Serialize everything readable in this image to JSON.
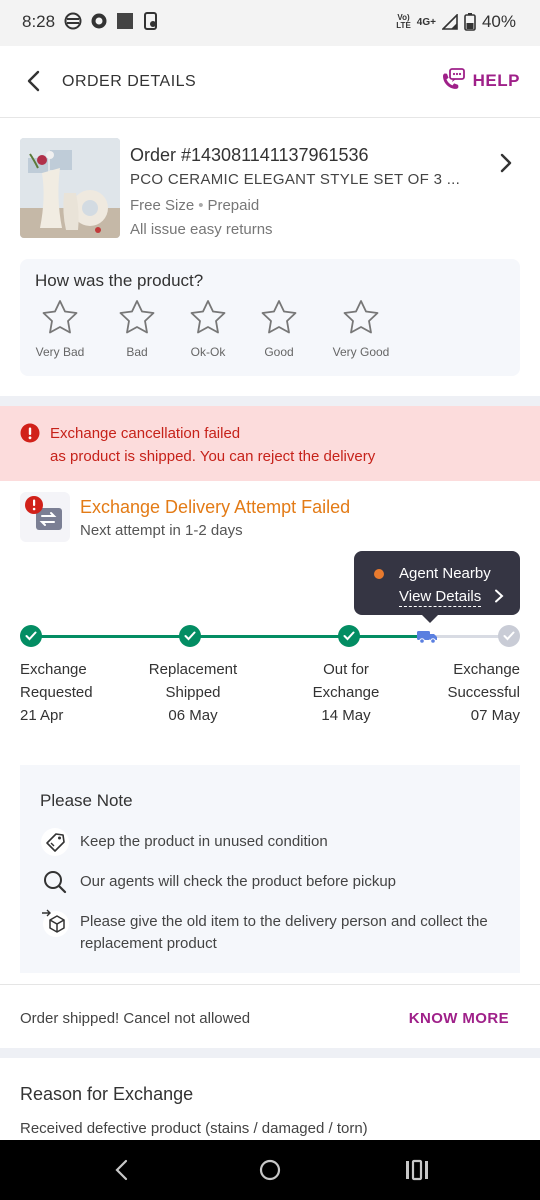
{
  "status_bar": {
    "time": "8:28",
    "network_top": "Vo)",
    "network_bottom": "LTE",
    "network_type": "4G+",
    "battery": "40%"
  },
  "header": {
    "title": "ORDER DETAILS",
    "help_label": "HELP",
    "accent_color": "#9f2089"
  },
  "order": {
    "id_text": "Order #143081141137961536",
    "product_name": "PCO CERAMIC ELEGANT STYLE SET OF 3 ...",
    "size": "Free Size",
    "payment": "Prepaid",
    "returns": "All issue easy returns"
  },
  "rating": {
    "question": "How was the product?",
    "options": [
      "Very Bad",
      "Bad",
      "Ok-Ok",
      "Good",
      "Very Good"
    ]
  },
  "error_banner": {
    "title": "Exchange cancellation failed",
    "subtitle": "as product is shipped. You can reject the delivery",
    "color": "#c6221a"
  },
  "attempt": {
    "title": "Exchange Delivery Attempt Failed",
    "subtitle": "Next attempt in 1-2 days",
    "color": "#e37b16"
  },
  "tooltip": {
    "label": "Agent Nearby",
    "link": "View Details"
  },
  "tracker": {
    "steps": [
      {
        "line1": "Exchange",
        "line2": "Requested",
        "date": "21 Apr",
        "status": "done"
      },
      {
        "line1": "Replacement",
        "line2": "Shipped",
        "date": "06 May",
        "status": "done"
      },
      {
        "line1": "Out for",
        "line2": "Exchange",
        "date": "14 May",
        "status": "done"
      },
      {
        "line1": "Exchange",
        "line2": "Successful",
        "date": "07 May",
        "status": "pending"
      }
    ],
    "done_color": "#038d63",
    "pending_color": "#c9ccd6"
  },
  "note": {
    "title": "Please Note",
    "items": [
      {
        "text": "Keep the product in unused condition",
        "icon": "tag-icon"
      },
      {
        "text": "Our agents will check the product before pickup",
        "icon": "search-icon"
      },
      {
        "text": "Please give the old item to the delivery person and collect the replacement product",
        "icon": "box-exchange-icon"
      }
    ]
  },
  "cancel": {
    "text": "Order shipped! Cancel not allowed",
    "link": "KNOW MORE"
  },
  "reason": {
    "title": "Reason for Exchange",
    "text": "Received defective product (stains / damaged / torn)"
  }
}
